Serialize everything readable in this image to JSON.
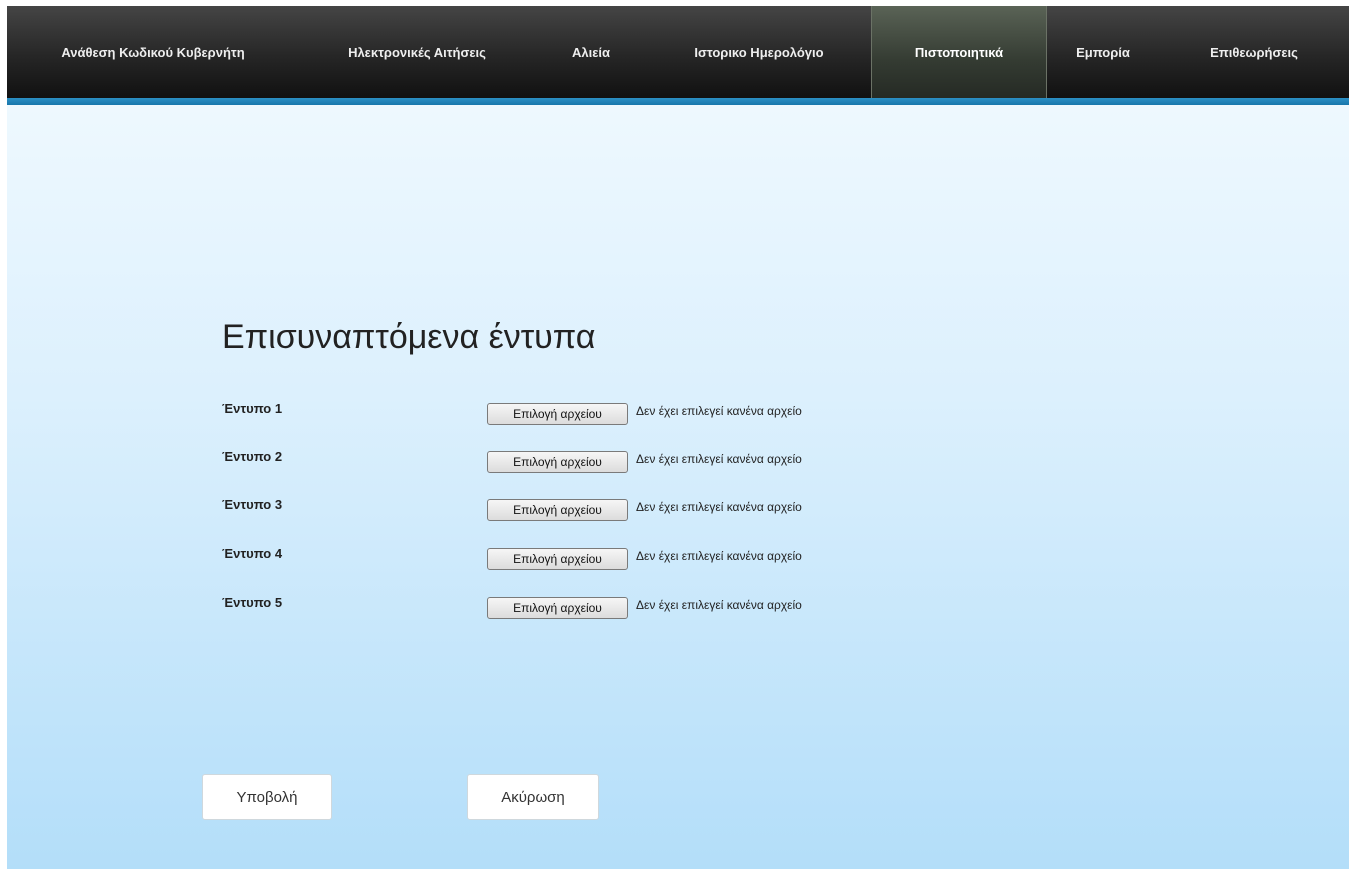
{
  "nav": {
    "items": [
      {
        "label": "Ανάθεση Κωδικού Κυβερνήτη"
      },
      {
        "label": "Ηλεκτρονικές Αιτήσεις"
      },
      {
        "label": "Αλιεία"
      },
      {
        "label": "Ιστορικο Ημερολόγιο"
      },
      {
        "label": "Πιστοποιητικά",
        "active": true
      },
      {
        "label": "Εμπορία"
      },
      {
        "label": "Επιθεωρήσεις"
      }
    ]
  },
  "main": {
    "title": "Επισυναπτόμενα έντυπα",
    "forms": [
      {
        "label": "Έντυπο 1",
        "button": "Επιλογή αρχείου",
        "status": "Δεν έχει επιλεγεί κανένα αρχείο"
      },
      {
        "label": "Έντυπο 2",
        "button": "Επιλογή αρχείου",
        "status": "Δεν έχει επιλεγεί κανένα αρχείο"
      },
      {
        "label": "Έντυπο 3",
        "button": "Επιλογή αρχείου",
        "status": "Δεν έχει επιλεγεί κανένα αρχείο"
      },
      {
        "label": "Έντυπο 4",
        "button": "Επιλογή αρχείου",
        "status": "Δεν έχει επιλεγεί κανένα αρχείο"
      },
      {
        "label": "Έντυπο 5",
        "button": "Επιλογή αρχείου",
        "status": "Δεν έχει επιλεγεί κανένα αρχείο"
      }
    ]
  },
  "actions": {
    "submit": "Υποβολή",
    "cancel": "Ακύρωση"
  },
  "colors": {
    "accent": "#1f80b6",
    "navbar": "#1f1f1f",
    "active_tab": "#3c4439"
  }
}
